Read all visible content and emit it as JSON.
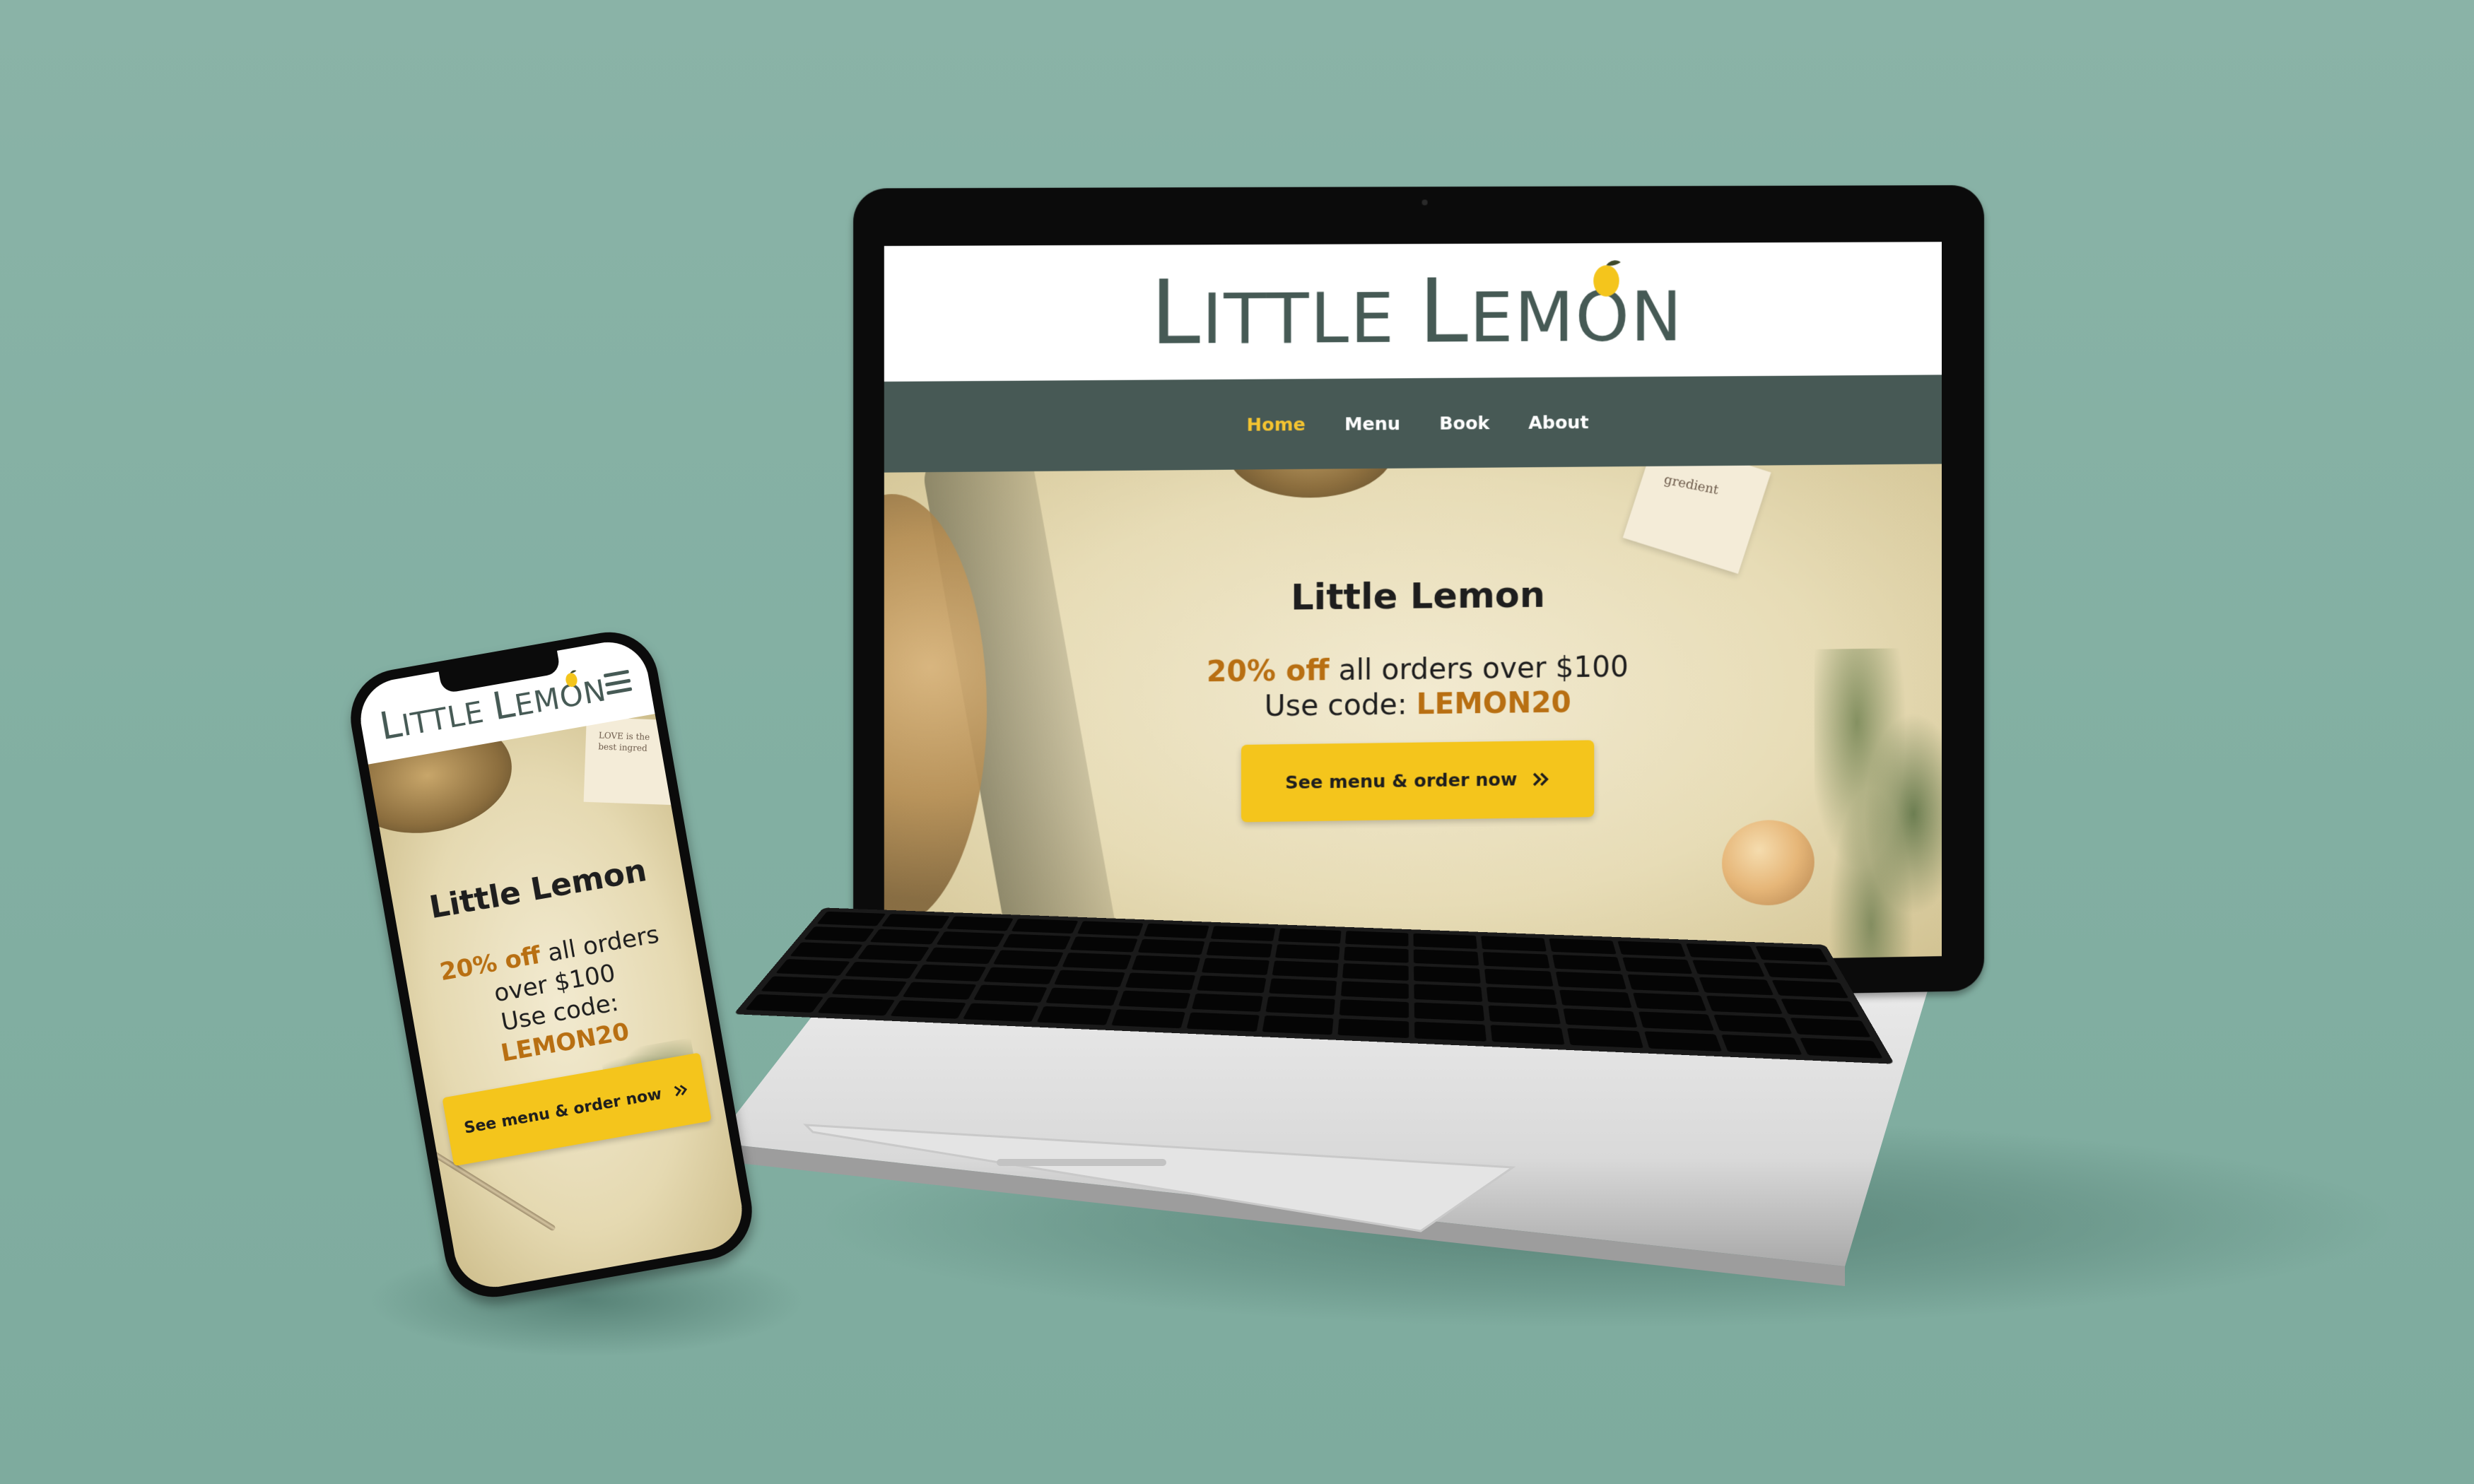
{
  "brand": {
    "name": "Little Lemon",
    "wordmark_first": "L",
    "wordmark_rest_1": "ittle ",
    "wordmark_second": "L",
    "wordmark_rest_2": "emon"
  },
  "desktop": {
    "nav": [
      {
        "label": "Home",
        "active": true
      },
      {
        "label": "Menu",
        "active": false
      },
      {
        "label": "Book",
        "active": false
      },
      {
        "label": "About",
        "active": false
      }
    ],
    "hero": {
      "title": "Little Lemon",
      "promo_highlight": "20% off",
      "promo_rest": " all orders over $100",
      "code_prefix": "Use code: ",
      "code": "LEMON20",
      "cta_label": "See menu & order now",
      "cta_icon": "double-chevron-right-icon",
      "napkin_text": "gredient"
    }
  },
  "mobile": {
    "menu_icon": "hamburger-menu-icon",
    "hero": {
      "title": "Little Lemon",
      "promo_highlight": "20% off",
      "promo_rest": " all orders over $100",
      "code_prefix": "Use code: ",
      "code": "LEMON20",
      "cta_label": "See menu & order now",
      "cta_icon": "double-chevron-right-icon",
      "paper_text": "LOVE is the best ingred"
    }
  },
  "colors": {
    "background": "#84b0a3",
    "brand_dark": "#465a55",
    "nav_bar": "#475955",
    "accent_yellow": "#f4c51c",
    "nav_active": "#f4c430",
    "promo_orange": "#b86f12"
  }
}
